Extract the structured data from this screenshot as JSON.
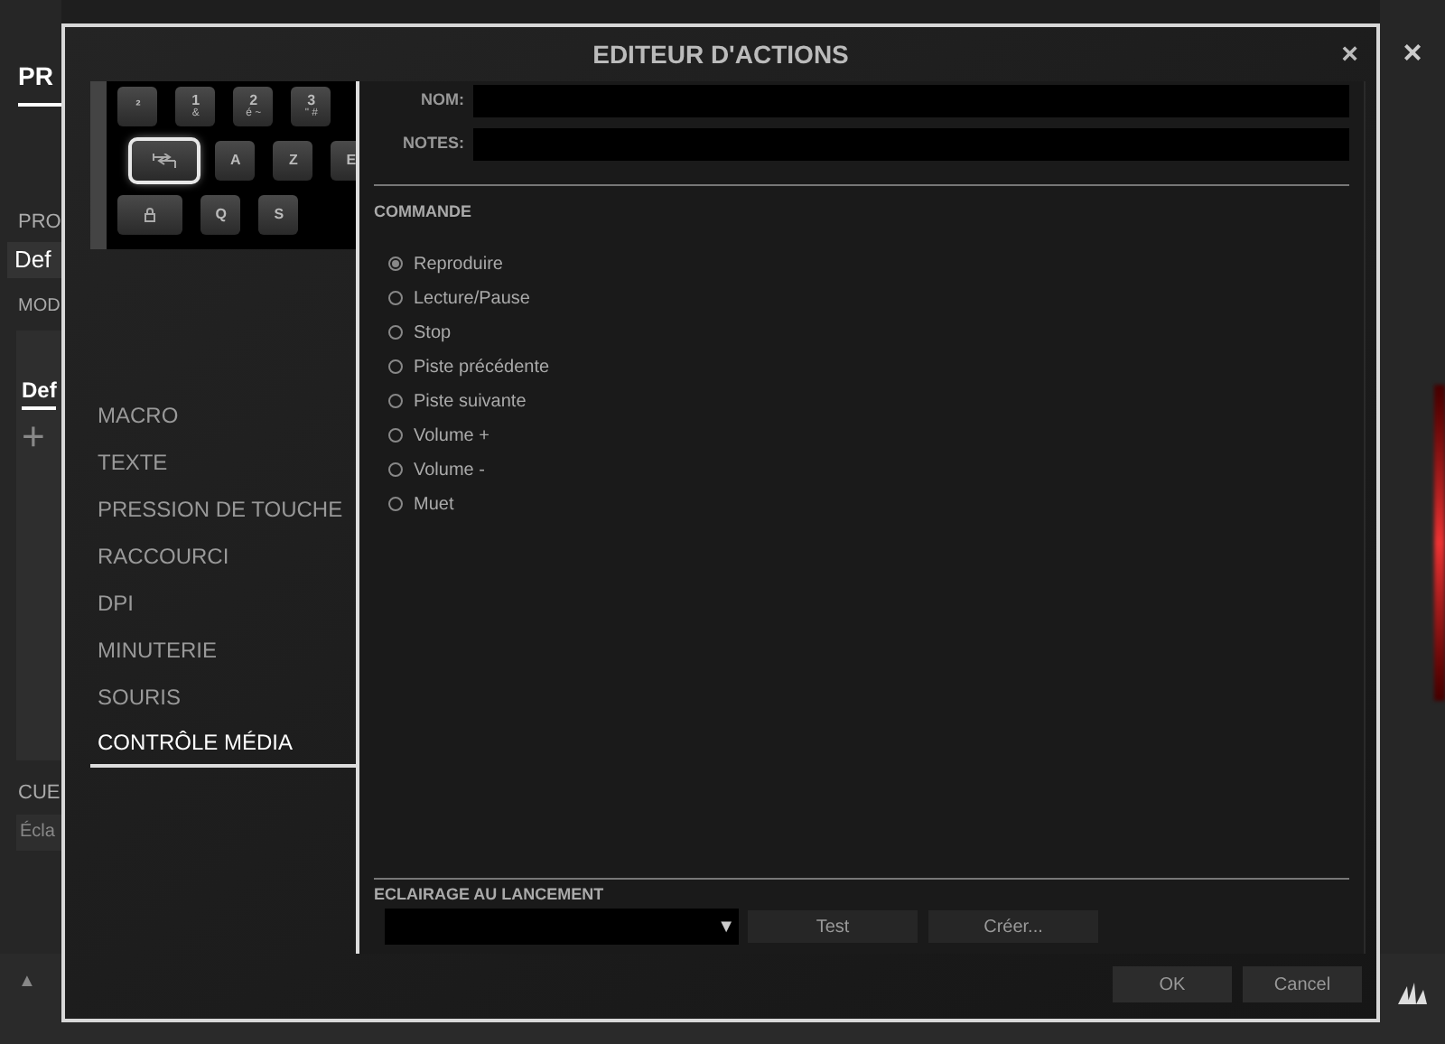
{
  "background_app": {
    "tab": "PR",
    "profile_label": "PRO",
    "profile_value": "Def",
    "mode_label": "MOD",
    "mode_tab": "Def",
    "add_icon": "+",
    "cue_label": "CUE",
    "lighting_value": "Écla",
    "close": "×",
    "scroll_up": "▲"
  },
  "dialog": {
    "title": "EDITEUR D'ACTIONS",
    "close": "×",
    "keyboard": {
      "rows": [
        [
          {
            "label": "²",
            "kind": "text",
            "selected": false
          },
          {
            "label": "1",
            "sub": "&",
            "kind": "text",
            "selected": false
          },
          {
            "label": "2",
            "sub": "é ~",
            "kind": "text",
            "selected": false
          },
          {
            "label": "3",
            "sub": "\" #",
            "kind": "text",
            "selected": false
          }
        ],
        [
          {
            "kind": "tab",
            "selected": true
          },
          {
            "label": "A",
            "kind": "text",
            "selected": false
          },
          {
            "label": "Z",
            "kind": "text",
            "selected": false
          },
          {
            "label": "E",
            "kind": "text",
            "selected": false
          }
        ],
        [
          {
            "kind": "lock",
            "selected": false
          },
          {
            "label": "Q",
            "kind": "text",
            "selected": false
          },
          {
            "label": "S",
            "kind": "text",
            "selected": false
          }
        ]
      ]
    },
    "menu": [
      {
        "label": "MACRO",
        "selected": false
      },
      {
        "label": "TEXTE",
        "selected": false
      },
      {
        "label": "PRESSION DE TOUCHE",
        "selected": false
      },
      {
        "label": "RACCOURCI",
        "selected": false
      },
      {
        "label": "DPI",
        "selected": false
      },
      {
        "label": "MINUTERIE",
        "selected": false
      },
      {
        "label": "SOURIS",
        "selected": false
      },
      {
        "label": "CONTRÔLE MÉDIA",
        "selected": true
      }
    ],
    "fields": [
      {
        "label": "NOM:"
      },
      {
        "label": "NOTES:"
      }
    ],
    "command": {
      "heading": "COMMANDE",
      "options": [
        {
          "label": "Reproduire",
          "selected": true
        },
        {
          "label": "Lecture/Pause",
          "selected": false
        },
        {
          "label": "Stop",
          "selected": false
        },
        {
          "label": "Piste précédente",
          "selected": false
        },
        {
          "label": "Piste suivante",
          "selected": false
        },
        {
          "label": "Volume +",
          "selected": false
        },
        {
          "label": "Volume -",
          "selected": false
        },
        {
          "label": "Muet",
          "selected": false
        }
      ]
    },
    "lighting": {
      "heading": "ECLAIRAGE AU LANCEMENT",
      "dropdown_arrow": "▼",
      "buttons": [
        "Test",
        "Créer..."
      ]
    },
    "buttons": [
      "OK",
      "Cancel"
    ]
  }
}
